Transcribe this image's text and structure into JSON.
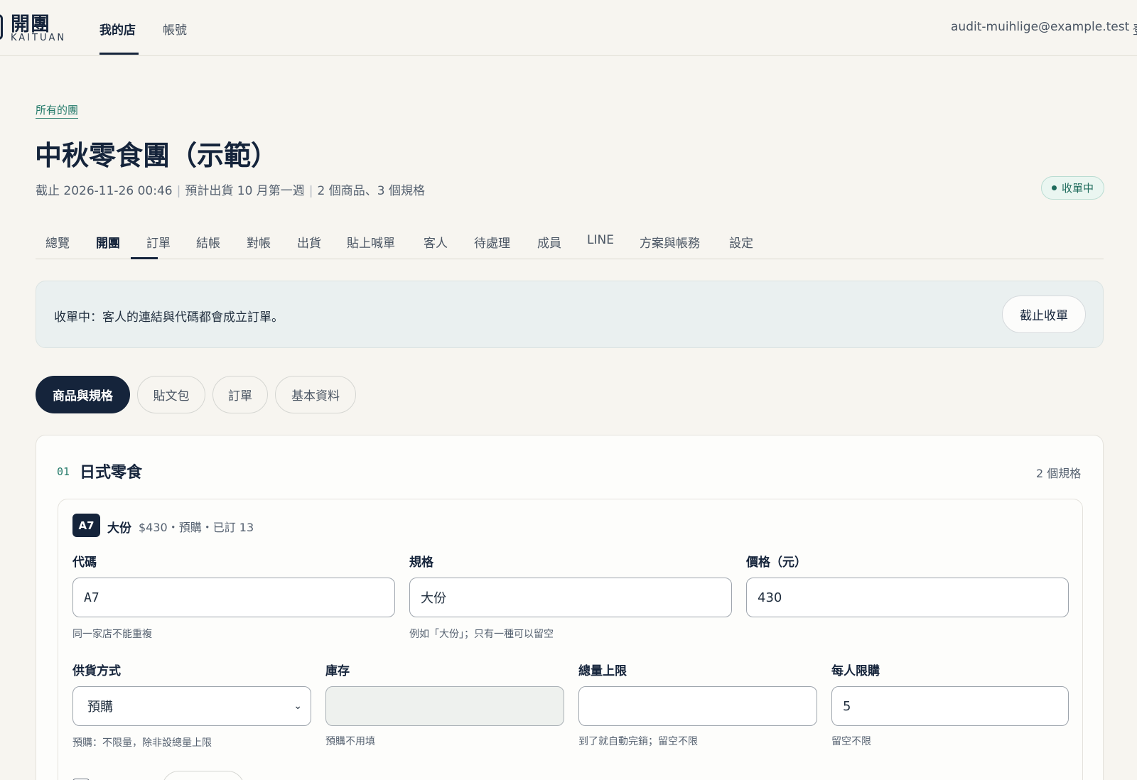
{
  "topbar": {
    "brand_name": "開團",
    "brand_sub": "KAITUAN",
    "nav": [
      "我的店",
      "帳號"
    ],
    "user_email": "audit-muihlige@example.test",
    "user_extra": "登"
  },
  "header": {
    "breadcrumb": "所有的團",
    "title": "中秋零食團（示範）",
    "meta": [
      "截止 2026-11-26 00:46",
      "預計出貨 10 月第一週",
      "2 個商品、3 個規格"
    ],
    "meta_sep": "|",
    "status": "收單中"
  },
  "tabs": [
    "總覽",
    "開團",
    "訂單",
    "結帳",
    "對帳",
    "出貨",
    "貼上喊單",
    "客人",
    "待處理",
    "成員",
    "LINE",
    "方案與帳務",
    "設定"
  ],
  "notice": {
    "text": "收單中：客人的連結與代碼都會成立訂單。",
    "button": "截止收單"
  },
  "subtabs": [
    "商品與規格",
    "貼文包",
    "訂單",
    "基本資料"
  ],
  "product": {
    "index": "01",
    "title": "日式零食",
    "variant_count": "2 個規格",
    "variant": {
      "code_badge": "A7",
      "name": "大份",
      "summary": "$430・預購・已訂 13",
      "fields": {
        "code": {
          "label": "代碼",
          "value": "A7",
          "help": "同一家店不能重複"
        },
        "spec": {
          "label": "規格",
          "value": "大份",
          "help": "例如「大份」；只有一種可以留空"
        },
        "price": {
          "label": "價格（元）",
          "value": "430"
        },
        "supply": {
          "label": "供貨方式",
          "value": "預購",
          "help": "預購：不限量，除非設總量上限"
        },
        "stock": {
          "label": "庫存",
          "value": "",
          "help": "預購不用填"
        },
        "total_limit": {
          "label": "總量上限",
          "value": "",
          "help": "到了就自動完銷；留空不限"
        },
        "per_person": {
          "label": "每人限購",
          "value": "5",
          "help": "留空不限"
        }
      }
    }
  },
  "colors": {
    "navy": "#15243b",
    "accent_green": "#247a6a",
    "status_bg": "#eaf6f1",
    "notice_bg": "#eaf0f0",
    "page_bg": "#f7f5f0"
  },
  "icons": {
    "status": "dot-icon",
    "select": "chevron-down-icon",
    "brand": "logo-mark-icon"
  }
}
